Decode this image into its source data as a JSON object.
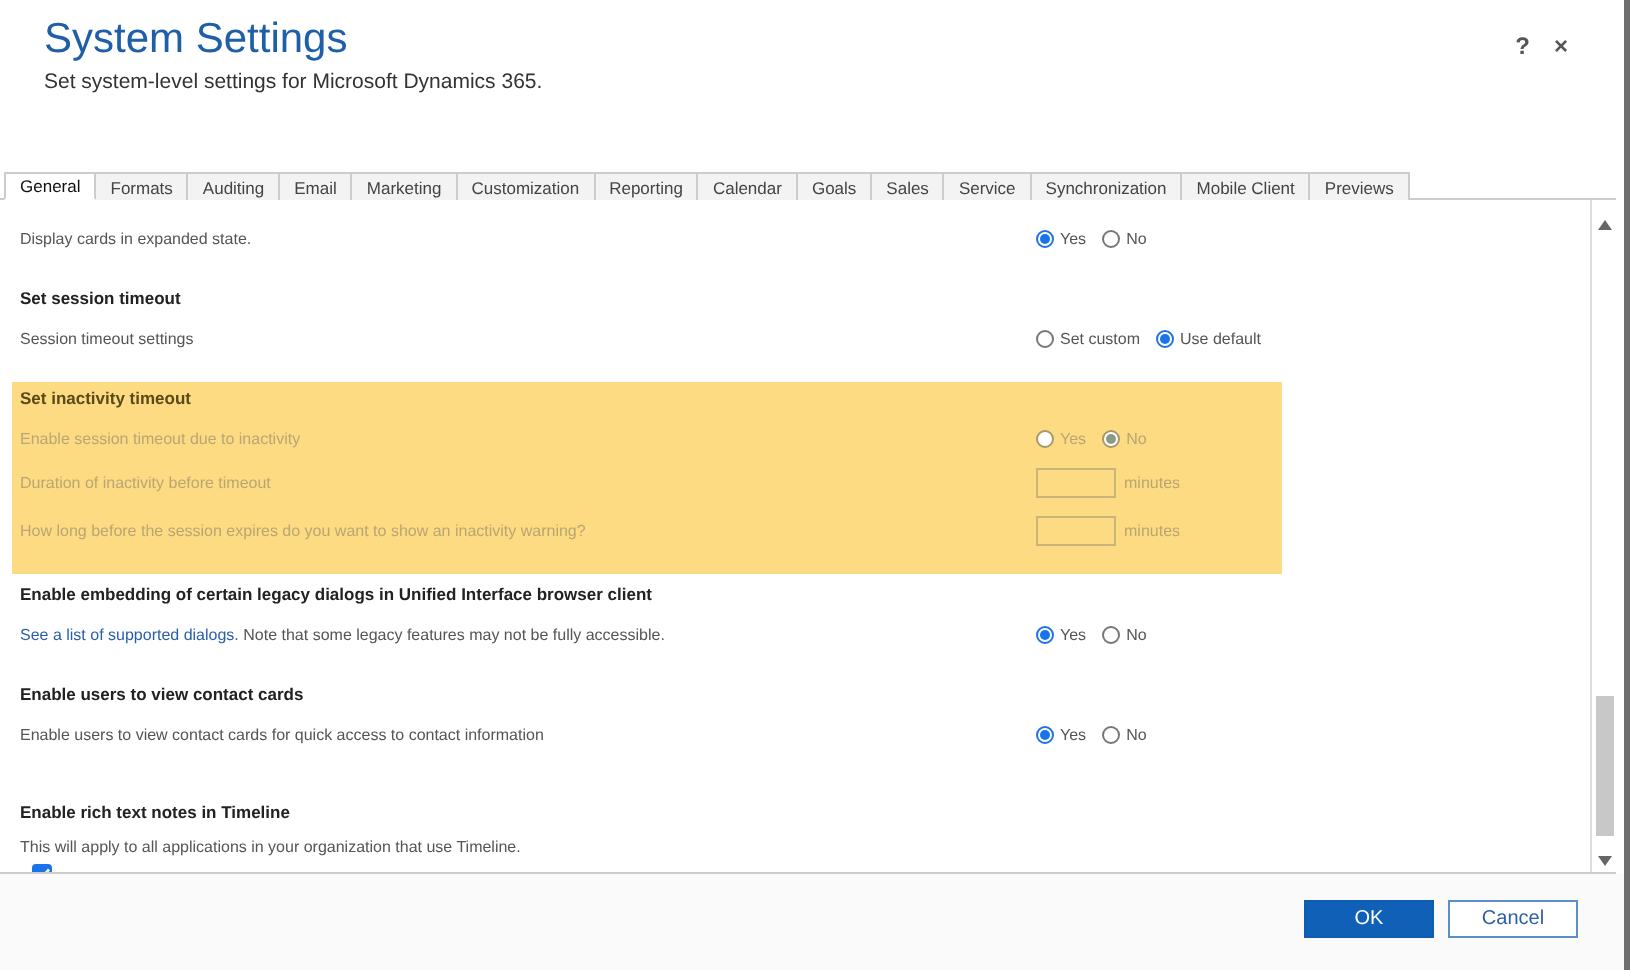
{
  "window": {
    "title": "System Settings",
    "subtitle": "Set system-level settings for Microsoft Dynamics 365.",
    "help": "?",
    "close": "×"
  },
  "tabs": [
    {
      "label": "General",
      "selected": true
    },
    {
      "label": "Formats",
      "selected": false
    },
    {
      "label": "Auditing",
      "selected": false
    },
    {
      "label": "Email",
      "selected": false
    },
    {
      "label": "Marketing",
      "selected": false
    },
    {
      "label": "Customization",
      "selected": false
    },
    {
      "label": "Reporting",
      "selected": false
    },
    {
      "label": "Calendar",
      "selected": false
    },
    {
      "label": "Goals",
      "selected": false
    },
    {
      "label": "Sales",
      "selected": false
    },
    {
      "label": "Service",
      "selected": false
    },
    {
      "label": "Synchronization",
      "selected": false
    },
    {
      "label": "Mobile Client",
      "selected": false
    },
    {
      "label": "Previews",
      "selected": false
    }
  ],
  "sections": [
    {
      "highlighted": false,
      "rows": [
        {
          "kind": "radio",
          "label": "Display cards in expanded state.",
          "options": [
            {
              "label": "Yes",
              "selected": true
            },
            {
              "label": "No",
              "selected": false
            }
          ]
        }
      ]
    },
    {
      "heading": "Set session timeout",
      "highlighted": false,
      "rows": [
        {
          "kind": "radio",
          "label": "Session timeout settings",
          "options": [
            {
              "label": "Set custom",
              "selected": false
            },
            {
              "label": "Use default",
              "selected": true
            }
          ]
        }
      ]
    },
    {
      "heading": "Set inactivity timeout",
      "highlighted": true,
      "rows": [
        {
          "kind": "radio",
          "disabled": true,
          "label": "Enable session timeout due to inactivity",
          "options": [
            {
              "label": "Yes",
              "selected": false
            },
            {
              "label": "No",
              "selected": true
            }
          ]
        },
        {
          "kind": "input",
          "disabled": true,
          "label": "Duration of inactivity before timeout",
          "unit": "minutes"
        },
        {
          "kind": "input",
          "disabled": true,
          "label": "How long before the session expires do you want to show an inactivity warning?",
          "unit": "minutes"
        }
      ]
    },
    {
      "heading": "Enable embedding of certain legacy dialogs in Unified Interface browser client",
      "highlighted": false,
      "rows": [
        {
          "kind": "radio",
          "link": "See a list of supported dialogs.",
          "label": "Note that some legacy features may not be fully accessible.",
          "options": [
            {
              "label": "Yes",
              "selected": true
            },
            {
              "label": "No",
              "selected": false
            }
          ]
        }
      ]
    },
    {
      "heading": "Enable users to view contact cards",
      "highlighted": false,
      "rows": [
        {
          "kind": "radio",
          "label": "Enable users to view contact cards for quick access to contact information",
          "options": [
            {
              "label": "Yes",
              "selected": true
            },
            {
              "label": "No",
              "selected": false
            }
          ]
        }
      ]
    },
    {
      "heading": "Enable rich text notes in Timeline",
      "highlighted": false,
      "rows": [
        {
          "kind": "text",
          "label": "This will apply to all applications in your organization that use Timeline."
        },
        {
          "kind": "checkbox",
          "checked": true
        }
      ]
    }
  ],
  "buttons": [
    {
      "label": "OK",
      "primary": true
    },
    {
      "label": "Cancel",
      "primary": false
    }
  ]
}
